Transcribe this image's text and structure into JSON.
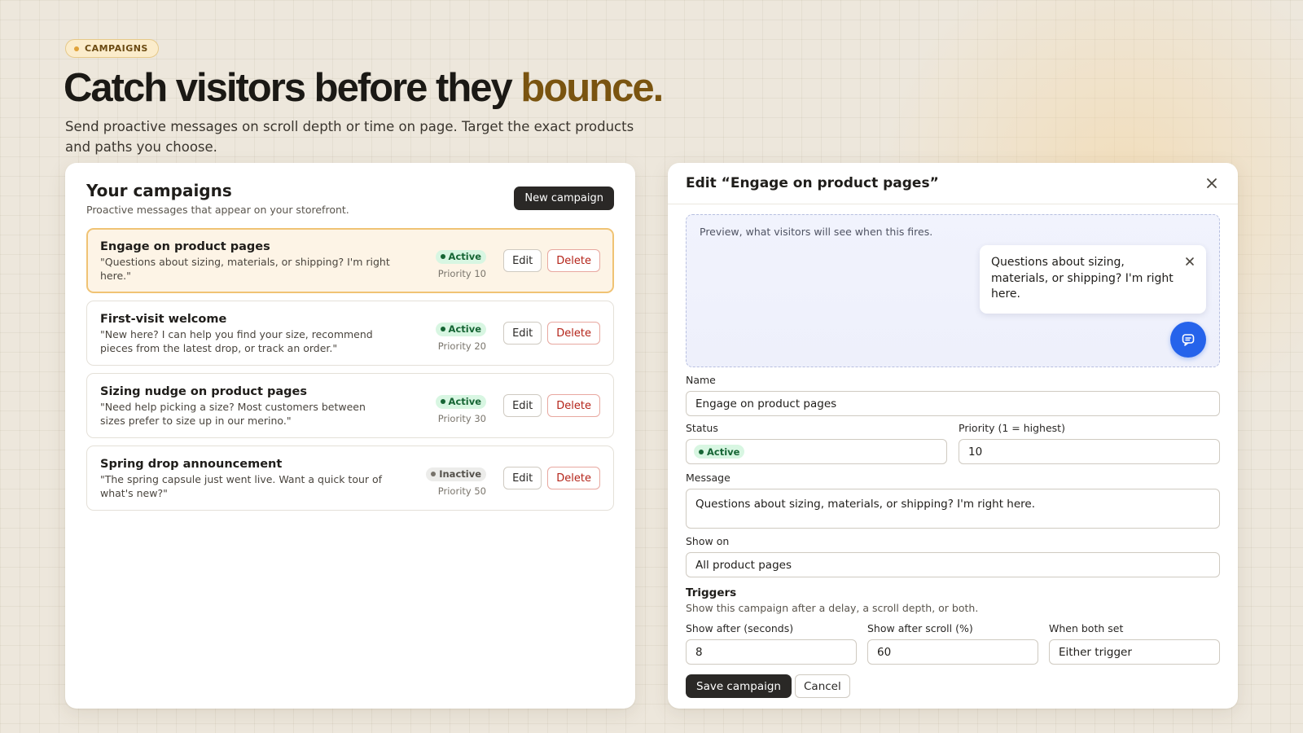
{
  "hero": {
    "eyebrow": "CAMPAIGNS",
    "title_main": "Catch visitors before they ",
    "title_accent": "bounce.",
    "subtitle": "Send proactive messages on scroll depth or time on page. Target the exact products and paths you choose."
  },
  "campaigns_panel": {
    "title": "Your campaigns",
    "subtitle": "Proactive messages that appear on your storefront.",
    "new_button": "New campaign",
    "edit_label": "Edit",
    "delete_label": "Delete",
    "items": [
      {
        "name": "Engage on product pages",
        "message": "\"Questions about sizing, materials, or shipping? I'm right here.\"",
        "status": "Active",
        "priority": "Priority 10"
      },
      {
        "name": "First-visit welcome",
        "message": "\"New here? I can help you find your size, recommend pieces from the latest drop, or track an order.\"",
        "status": "Active",
        "priority": "Priority 20"
      },
      {
        "name": "Sizing nudge on product pages",
        "message": "\"Need help picking a size? Most customers between sizes prefer to size up in our merino.\"",
        "status": "Active",
        "priority": "Priority 30"
      },
      {
        "name": "Spring drop announcement",
        "message": "\"The spring capsule just went live. Want a quick tour of what's new?\"",
        "status": "Inactive",
        "priority": "Priority 50"
      }
    ]
  },
  "editor": {
    "title": "Edit “Engage on product pages”",
    "preview_label": "Preview, what visitors will see when this fires.",
    "preview_message": "Questions about sizing, materials, or shipping? I'm right here.",
    "name_label": "Name",
    "name_value": "Engage on product pages",
    "status_label": "Status",
    "status_value": "Active",
    "priority_label": "Priority (1 = highest)",
    "priority_value": "10",
    "message_label": "Message",
    "message_value": "Questions about sizing, materials, or shipping? I'm right here.",
    "show_on_label": "Show on",
    "show_on_value": "All product pages",
    "triggers_title": "Triggers",
    "triggers_sub": "Show this campaign after a delay, a scroll depth, or both.",
    "delay_label": "Show after (seconds)",
    "delay_value": "8",
    "scroll_label": "Show after scroll (%)",
    "scroll_value": "60",
    "both_label": "When both set",
    "both_value": "Either trigger",
    "save_button": "Save campaign",
    "cancel_button": "Cancel"
  },
  "colors": {
    "accent": "#7a5410",
    "primary_button": "#2a2826",
    "active_badge": "#d8f6e2",
    "danger": "#b42318",
    "chat_fab": "#2563eb"
  }
}
